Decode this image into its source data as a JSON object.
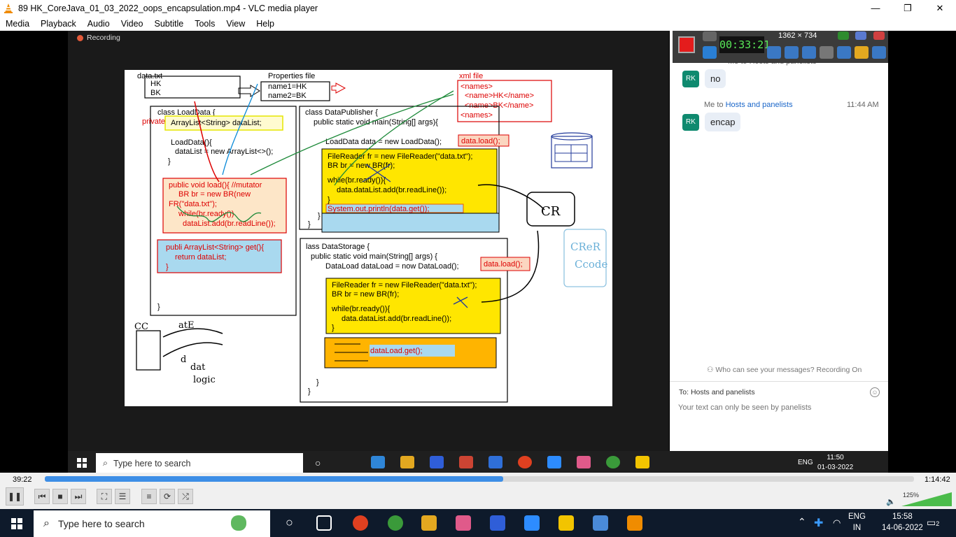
{
  "window": {
    "title": "89 HK_CoreJava_01_03_2022_oops_encapsulation.mp4 - VLC media player",
    "minimize": "—",
    "maximize": "❐",
    "close": "✕"
  },
  "menu": [
    "Media",
    "Playback",
    "Audio",
    "Video",
    "Subtitle",
    "Tools",
    "View",
    "Help"
  ],
  "meeting": {
    "recording_label": "Recording"
  },
  "slide": {
    "data_txt": {
      "label": "data.txt",
      "lines": [
        "HK",
        "BK"
      ]
    },
    "properties": {
      "label": "Properties file",
      "lines": [
        "name1=HK",
        "name2=BK"
      ]
    },
    "xml": {
      "label": "xml file",
      "lines": [
        "<names>",
        "<name>HK</name>",
        "<name>BK</name>",
        "<names>"
      ]
    },
    "loaddata": {
      "header": "class LoadData {",
      "private": "private",
      "field": "ArrayList<String> dataList;",
      "ctor1": "LoadData(){",
      "ctor2": "dataList = new ArrayList<>();",
      "ctor3": "}",
      "load1": "public void load(){ //mutator",
      "load2": "BR br = new BR(new",
      "load3": "FR(\"data.txt\");",
      "load4": "while(br.ready())",
      "load5": "dataList.add(br.readLine());",
      "get1": "publi ArrayList<String> get(){",
      "get2": "return dataList;",
      "get3": "}",
      "close": "}"
    },
    "publisher": {
      "header": "class DataPublisher {",
      "main": "public static void main(String[] args){",
      "new": "LoadData data = new LoadData();",
      "callout": "data.load();",
      "y1": "FileReader fr = new  FileReader(\"data.txt\");",
      "y2": "BR br = new BR(fr);",
      "y3": "while(br.ready()){",
      "y4": "data.dataList.add(br.readLine());",
      "y5": "}",
      "sysout": "System.out.println(data.get());",
      "close1": "}",
      "close2": "}"
    },
    "storage": {
      "header": "lass DataStorage {",
      "main": "public static void main(String[] args) {",
      "new": "DataLoad dataLoad = now DataLoad();",
      "callout": "data.load();",
      "y1": "FileReader fr = new  FileReader(\"data.txt\");",
      "y2": "BR br = new BR(fr);",
      "y3": "while(br.ready()){",
      "y4": "data.dataList.add(br.readLine());",
      "y5": "}",
      "get": "dataLoad.get();",
      "close1": "}",
      "close2": "}"
    },
    "handwriting": {
      "cc": "CC",
      "ate": "atE",
      "d": "d",
      "dat": "dat",
      "logic": "logic",
      "cr": "CR",
      "crelt": "CReR",
      "ccode": "Ccode"
    }
  },
  "recorder": {
    "timer": "00:33:21",
    "resolution": "1362 × 734"
  },
  "chat": {
    "header_partial": "Me to Hosts and panelists",
    "messages": [
      {
        "avatar": "RK",
        "text": "no"
      },
      {
        "avatar": "RK",
        "text": "encap"
      }
    ],
    "meta2": {
      "prefix": "Me to ",
      "link": "Hosts and panelists",
      "time": "11:44 AM"
    },
    "privacy": "Who can see your messages? Recording On",
    "to_label": "To:",
    "to_value": "Hosts and panelists",
    "compose_placeholder": "Your text can only be seen by panelists"
  },
  "inner_taskbar": {
    "search": "Type here to search",
    "lang": "ENG",
    "time": "11:50",
    "date": "01-03-2022"
  },
  "player": {
    "elapsed": "39:22",
    "total": "1:14:42",
    "progress": 0.527,
    "volume_label": "125%"
  },
  "taskbar": {
    "search": "Type here to search",
    "lang1": "ENG",
    "lang2": "IN",
    "time": "15:58",
    "date": "14-06-2022",
    "notifications": "2"
  }
}
